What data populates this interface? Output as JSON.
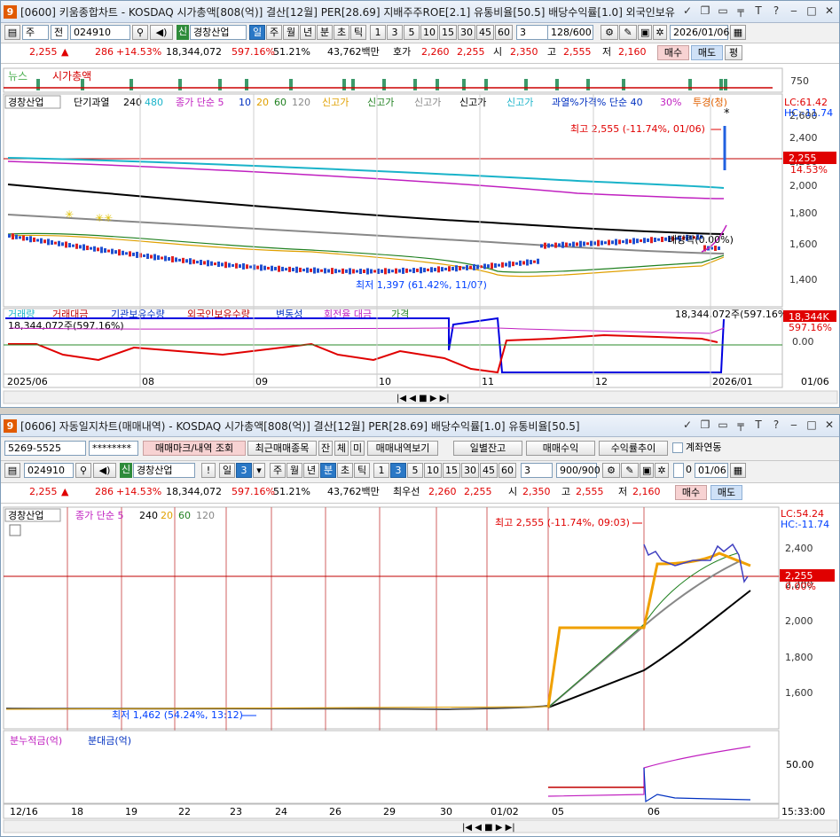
{
  "top": {
    "logo": "9",
    "title": "[0600] 키움종합차트 - KOSDAQ 시가총액[808(억)] 결산[12월] PER[28.69] 지배주주ROE[2.1] 유통비율[50.5] 배당수익률[1.0] 외국인보유",
    "window_controls": [
      "✓",
      "❐",
      "🗗",
      "╤",
      "T",
      "?",
      "-",
      "❐",
      "×"
    ],
    "toolbar": {
      "market_select": "주",
      "market_type": "전",
      "code": "024910",
      "sin_badge": "신",
      "name": "경창산업",
      "periods": [
        "일",
        "주",
        "월",
        "년",
        "분",
        "초",
        "틱"
      ],
      "selected_period": "일",
      "intervals": [
        "1",
        "3",
        "5",
        "10",
        "15",
        "30",
        "45",
        "60"
      ],
      "interval_value": "3",
      "count": "128/600",
      "date": "2026/01/06"
    },
    "quote": {
      "price": "2,255",
      "change_sign": "▲",
      "change": "286",
      "change_pct": "+14.53%",
      "volume": "18,344,072",
      "vol_ratio": "597.16%",
      "turnover": "51.21%",
      "amount": "43,762백만",
      "hoga_label": "호가",
      "ask": "2,260",
      "bid": "2,255",
      "open_label": "시",
      "open": "2,350",
      "high_label": "고",
      "high": "2,555",
      "low_label": "저",
      "low": "2,160",
      "buy": "매수",
      "sell": "매도",
      "eval": "평"
    },
    "news_row": {
      "news": "뉴스",
      "mcap": "시가총액",
      "tick": "750"
    },
    "legend": {
      "name": "경창산업",
      "l1": "단기과열",
      "l2": "240",
      "l3": "480",
      "l4": "종가 단순 5",
      "l5": "10",
      "l6": "20",
      "l7": "60",
      "l8": "120",
      "l9": "신고가",
      "l10": "신고가",
      "l11": "신고가",
      "l12": "신고가",
      "l13": "신고가",
      "l14": "과열%가격% 단순 40",
      "l15": "30%",
      "l16": "투경(청)"
    },
    "lc": "LC:61.42",
    "hc": "HC:-11.74",
    "price_ticks": [
      "2,600",
      "2,400",
      "2,200",
      "2,000",
      "1,800",
      "1,600",
      "1,400"
    ],
    "price_label": "2,255",
    "price_label_pct": "14.53%",
    "annot_high": "최고 2,555 (-11.74%, 01/06)",
    "annot_low": "최저 1,397 (61.42%, 11/07)",
    "annot_div": "배당락(0.00%)",
    "vol_legend": [
      "거래량",
      "거래대금",
      "기관보유수량",
      "외국인보유수량",
      "변동성",
      "회전율 대금",
      "가격"
    ],
    "vol_total": "18,344,072주(597.16%)",
    "vol_left": "18,344,072주(597.16%)",
    "vol_tag": "18,344K",
    "vol_pct": "597.16%",
    "vol_zero": "0.00",
    "x_labels": [
      "2025/06",
      "08",
      "09",
      "10",
      "11",
      "12",
      "2026/01"
    ],
    "x_right": "01/06"
  },
  "bottom": {
    "logo": "9",
    "title": "[0606] 자동일지차트(매매내역) - KOSDAQ 시가총액[808(억)] 결산[12월] PER[28.69] 배당수익률[1.0] 유통비율[50.5]",
    "window_controls": [
      "✓",
      "❐",
      "🗗",
      "╤",
      "T",
      "?",
      "-",
      "❐",
      "×"
    ],
    "account": "5269-5525",
    "password": "********",
    "btns": [
      "매매마크/내역 조회",
      "최근매매종목",
      "잔",
      "체",
      "미",
      "매매내역보기"
    ],
    "right_btns": [
      "일별잔고",
      "매매수익",
      "수익률추이"
    ],
    "link_label": "계좌연동",
    "toolbar": {
      "code": "024910",
      "sin_badge": "신",
      "name": "경창산업",
      "excl": "!",
      "day_label": "일",
      "day_value": "3",
      "periods": [
        "주",
        "월",
        "년",
        "분",
        "초",
        "틱"
      ],
      "selected_period": "분",
      "intervals": [
        "1",
        "3",
        "5",
        "10",
        "15",
        "30",
        "45",
        "60"
      ],
      "selected_interval": "3",
      "interval_value": "3",
      "count": "900/900",
      "zero": "0",
      "date": "01/06"
    },
    "quote": {
      "price": "2,255",
      "change_sign": "▲",
      "change": "286",
      "change_pct": "+14.53%",
      "volume": "18,344,072",
      "vol_ratio": "597.16%",
      "turnover": "51.21%",
      "amount": "43,762백만",
      "best_label": "최우선",
      "ask": "2,260",
      "bid": "2,255",
      "open_label": "시",
      "open": "2,350",
      "high_label": "고",
      "high": "2,555",
      "low_label": "저",
      "low": "2,160",
      "buy": "매수",
      "sell": "매도"
    },
    "legend": {
      "name": "경창산업",
      "l1": "종가 단순 5",
      "l2": "240",
      "l3": "20",
      "l4": "60",
      "l5": "120"
    },
    "lc": "LC:54.24",
    "hc": "HC:-11.74",
    "price_ticks": [
      "2,400",
      "2,200",
      "2,000",
      "1,800",
      "1,600"
    ],
    "price_label": "2,255",
    "price_label_pct": "0.00%",
    "annot_high": "최고 2,555 (-11.74%, 09:03)",
    "annot_low": "최저 1,462 (54.24%, 13:12)",
    "sub_legend": [
      "분누적금(억)",
      "분대금(억)"
    ],
    "sub_tick": "50.00",
    "x_labels": [
      "12/16",
      "18",
      "19",
      "22",
      "23",
      "24",
      "26",
      "29",
      "30",
      "01/02",
      "05",
      "06"
    ],
    "x_right": "15:33:00"
  }
}
